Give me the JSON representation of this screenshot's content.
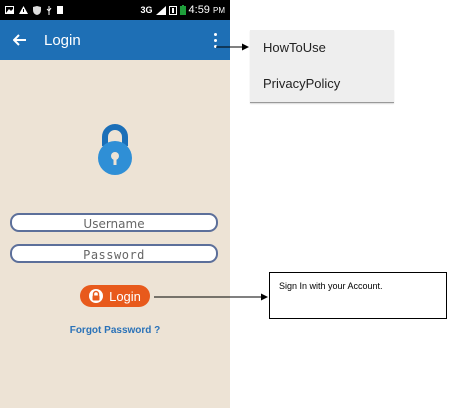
{
  "status_bar": {
    "network": "3G",
    "time": "4:59",
    "ampm": "PM",
    "icons": [
      "gallery-icon",
      "warning-icon",
      "shield-icon",
      "usb-icon",
      "sd-card-icon",
      "signal-icon",
      "battery-icon"
    ]
  },
  "app_bar": {
    "back_icon": "back-arrow-icon",
    "title": "Login",
    "overflow_icon": "more-vert-icon",
    "color": "#1e6fb5"
  },
  "form": {
    "username_placeholder": "Username",
    "password_placeholder": "Password",
    "login_label": "Login",
    "login_color": "#e85a1c",
    "forgot_label": "Forgot Password ?"
  },
  "overflow_menu": {
    "items": [
      {
        "label": "HowToUse"
      },
      {
        "label": "PrivacyPolicy"
      }
    ]
  },
  "annotation": {
    "text": "Sign In with your  Account."
  }
}
